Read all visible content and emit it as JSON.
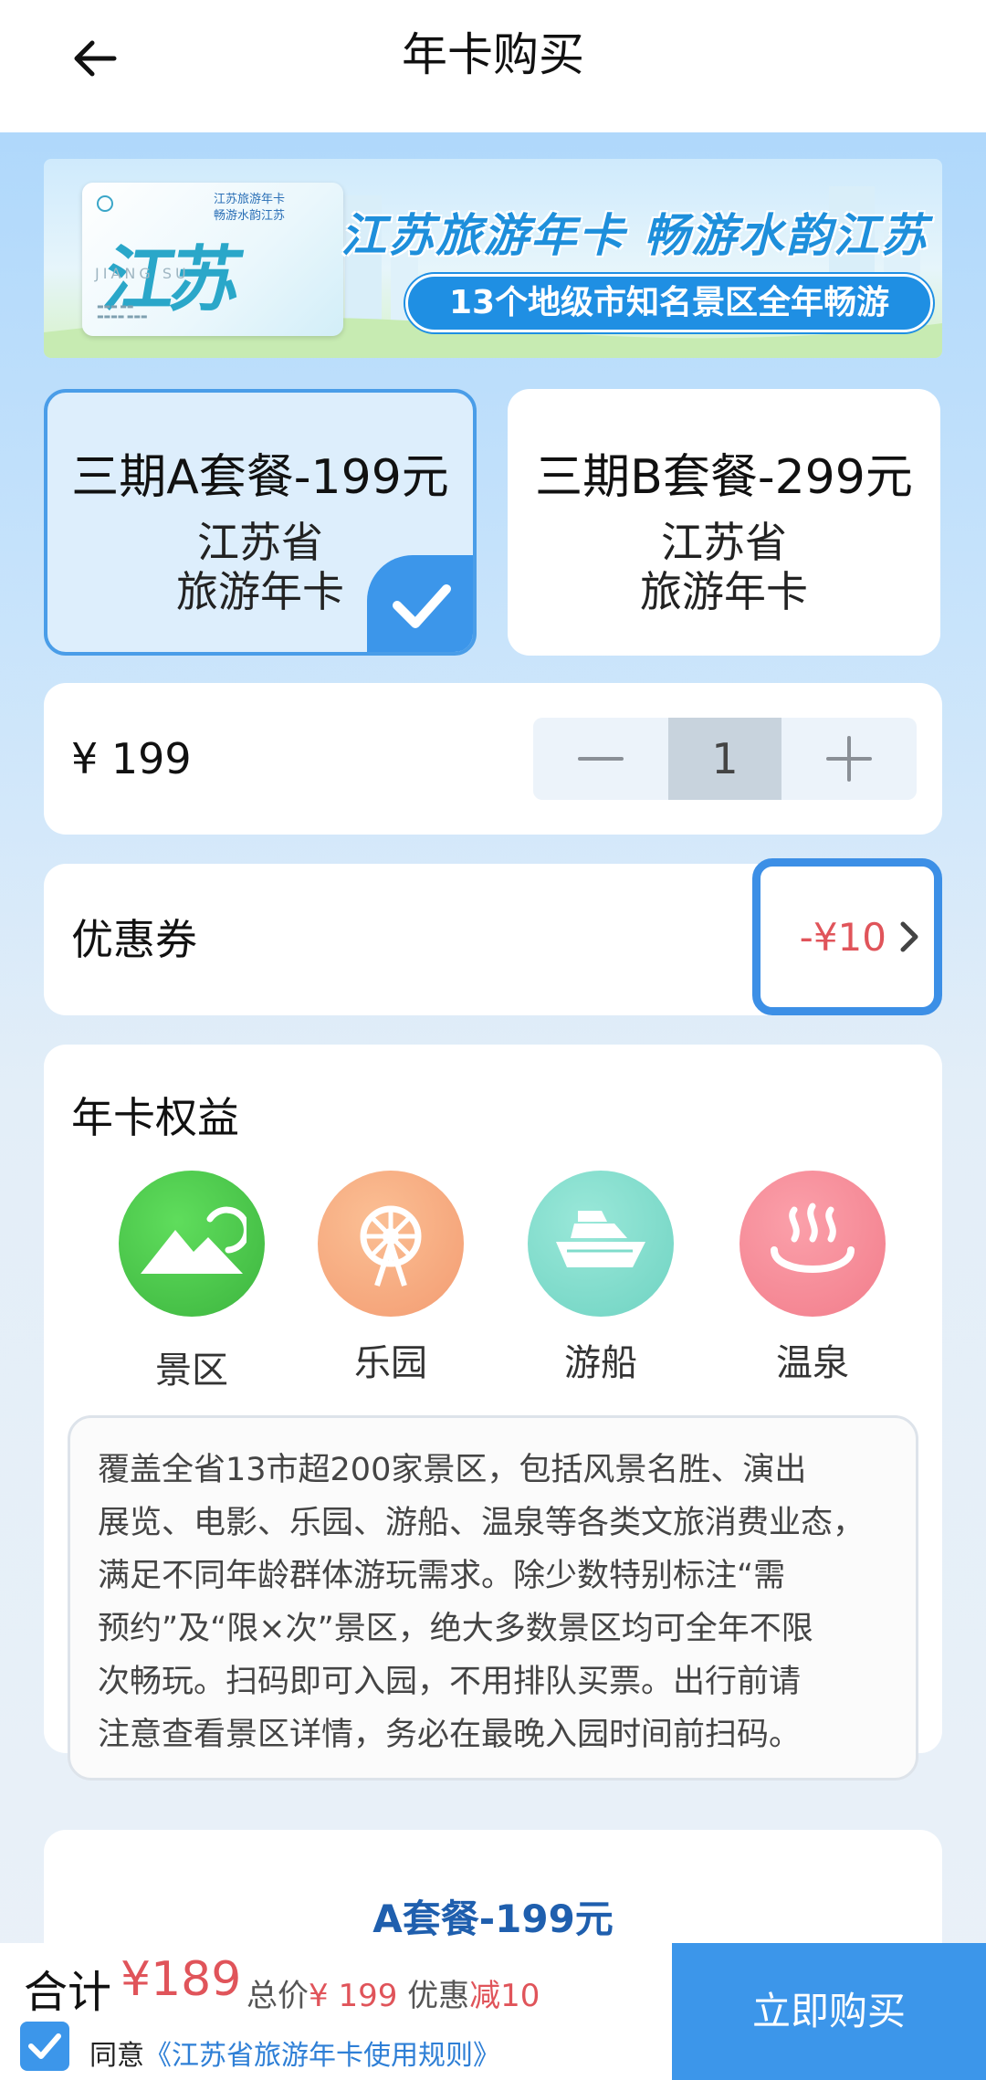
{
  "header": {
    "title": "年卡购买",
    "back_icon": "arrow-left-icon"
  },
  "banner": {
    "card_title": "江苏旅游年卡",
    "card_subtitle": "畅游水韵江苏",
    "card_calligraphy": "江苏",
    "card_pinyin": "JIANG SU",
    "headline": "江苏旅游年卡  畅游水韵江苏",
    "subline": "13个地级市知名景区全年畅游"
  },
  "packages": [
    {
      "name": "三期A套餐-199元",
      "line1": "江苏省",
      "line2": "旅游年卡",
      "selected": true
    },
    {
      "name": "三期B套餐-299元",
      "line1": "江苏省",
      "line2": "旅游年卡",
      "selected": false
    }
  ],
  "quantity": {
    "price": "¥ 199",
    "value": "1",
    "minus_icon": "minus-icon",
    "plus_icon": "plus-icon"
  },
  "coupon": {
    "label": "优惠券",
    "value": "-¥10",
    "arrow_icon": "chevron-right-icon"
  },
  "benefits": {
    "title": "年卡权益",
    "items": [
      {
        "label": "景区",
        "icon": "mountain-icon",
        "color": "#4cc94e"
      },
      {
        "label": "乐园",
        "icon": "ferris-wheel-icon",
        "color": "#f6a97a"
      },
      {
        "label": "游船",
        "icon": "ship-icon",
        "color": "#7fdccb"
      },
      {
        "label": "温泉",
        "icon": "hot-spring-icon",
        "color": "#f78a96"
      }
    ],
    "description": [
      "覆盖全省13市超200家景区，包括风景名胜、演出",
      "展览、电影、乐园、游船、温泉等各类文旅消费业态，",
      "满足不同年龄群体游玩需求。除少数特别标注“需",
      "预约”及“限×次”景区，绝大多数景区均可全年不限",
      "次畅玩。扫码即可入园，不用排队买票。出行前请",
      "注意查看景区详情，务必在最晚入园时间前扫码。"
    ]
  },
  "package_detail": {
    "title": "A套餐-199元"
  },
  "footer": {
    "total_label": "合计",
    "total_amount": "¥189",
    "total_price_label": "总价",
    "total_price": "¥ 199",
    "discount_label": "优惠",
    "discount_value": "减10",
    "agree_prefix": "同意",
    "agree_link": "《江苏省旅游年卡使用规则》",
    "buy_label": "立即购买"
  }
}
